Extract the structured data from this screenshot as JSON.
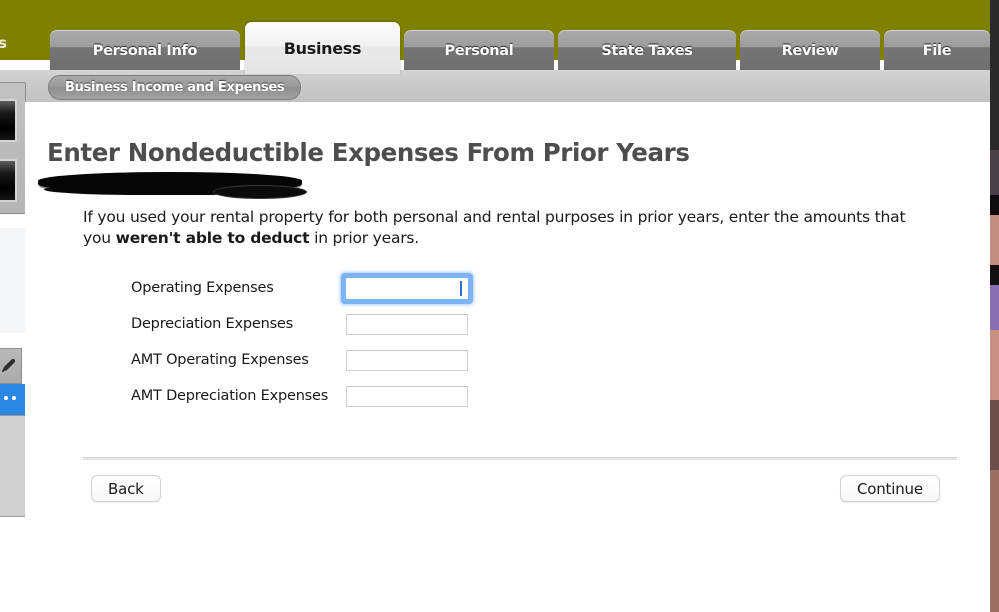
{
  "app": {
    "header_color": "#7f8000",
    "clipped_left_label": "s"
  },
  "tabs": [
    {
      "label": "Personal Info",
      "active": false
    },
    {
      "label": "Business",
      "active": true
    },
    {
      "label": "Personal",
      "active": false
    },
    {
      "label": "State Taxes",
      "active": false
    },
    {
      "label": "Review",
      "active": false
    },
    {
      "label": "File",
      "active": false
    }
  ],
  "breadcrumb": {
    "label": "Business Income and Expenses"
  },
  "left_palette": {
    "pencil_icon": "pencil-icon",
    "arrow_icon": "blue-arrow-icon",
    "swatch_count": 2
  },
  "main": {
    "title": "Enter Nondeductible Expenses From Prior Years",
    "redaction_present": true,
    "body_prefix": "If you used your rental property for both personal and rental purposes in prior years, enter the amounts that you ",
    "body_bold": "weren't able to deduct",
    "body_suffix": " in prior years."
  },
  "form": {
    "fields": [
      {
        "label": "Operating Expenses",
        "value": "",
        "placeholder": "",
        "focused": true
      },
      {
        "label": "Depreciation Expenses",
        "value": "",
        "placeholder": "",
        "focused": false
      },
      {
        "label": "AMT Operating Expenses",
        "value": "",
        "placeholder": "",
        "focused": false
      },
      {
        "label": "AMT Depreciation Expenses",
        "value": "",
        "placeholder": "",
        "focused": false
      }
    ]
  },
  "footer": {
    "back_label": "Back",
    "continue_label": "Continue"
  },
  "colors": {
    "olive": "#7f8000",
    "focus_blue": "#7eb3f5",
    "arrow_blue": "#2b87e3"
  }
}
